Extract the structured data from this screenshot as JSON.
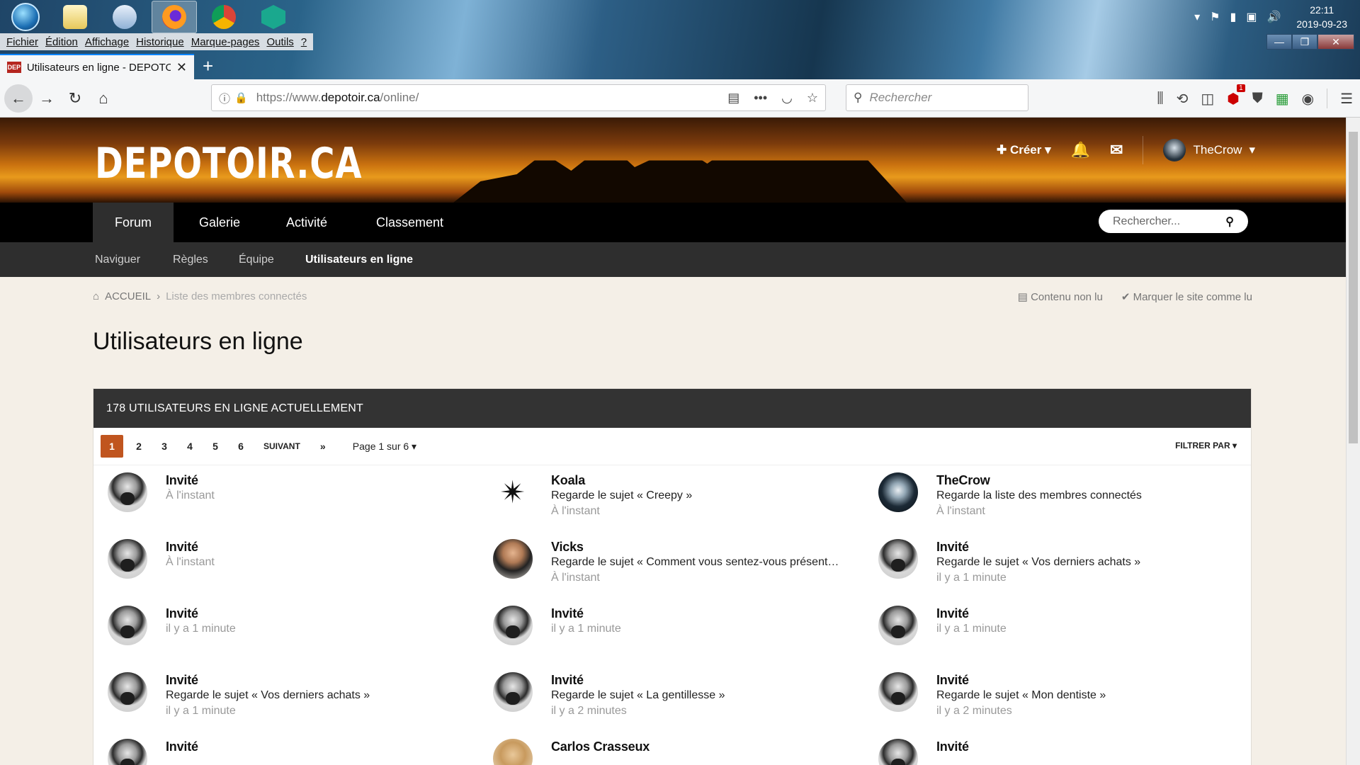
{
  "os": {
    "clock_time": "22:11",
    "clock_date": "2019-09-23"
  },
  "menu": [
    "Fichier",
    "Édition",
    "Affichage",
    "Historique",
    "Marque-pages",
    "Outils",
    "?"
  ],
  "tab": {
    "favicon": "DEP",
    "title": "Utilisateurs en ligne - DEPOTOIR.CA"
  },
  "url": {
    "prefix": "https://www.",
    "host": "depotoir.ca",
    "path": "/online/"
  },
  "browser_search_placeholder": "Rechercher",
  "ublock_count": "1",
  "site": {
    "logo": "DEPOTOIR.CA",
    "create_label": "Créer",
    "username": "TheCrow",
    "nav": [
      "Forum",
      "Galerie",
      "Activité",
      "Classement"
    ],
    "search_placeholder": "Rechercher...",
    "subnav": [
      "Naviguer",
      "Règles",
      "Équipe",
      "Utilisateurs en ligne"
    ],
    "breadcrumb_home": "ACCUEIL",
    "breadcrumb_current": "Liste des membres connectés",
    "unread_label": "Contenu non lu",
    "mark_read_label": "Marquer le site comme lu",
    "page_title": "Utilisateurs en ligne",
    "panel_title": "178 UTILISATEURS EN LIGNE ACTUELLEMENT",
    "pages": [
      "1",
      "2",
      "3",
      "4",
      "5",
      "6"
    ],
    "next_label": "SUIVANT",
    "last_label": "»",
    "page_select": "Page 1 sur 6",
    "filter_label": "FILTRER PAR"
  },
  "members": [
    {
      "name": "Invité",
      "activity": "",
      "time": "À l'instant",
      "avatar": "guest"
    },
    {
      "name": "Koala",
      "activity": "Regarde le sujet « Creepy »",
      "time": "À l'instant",
      "avatar": "koala"
    },
    {
      "name": "TheCrow",
      "activity": "Regarde la liste des membres connectés",
      "time": "À l'instant",
      "avatar": "crow"
    },
    {
      "name": "Invité",
      "activity": "",
      "time": "À l'instant",
      "avatar": "guest"
    },
    {
      "name": "Vicks",
      "activity": "Regarde le sujet « Comment vous sentez-vous présente…",
      "time": "À l'instant",
      "avatar": "vicks"
    },
    {
      "name": "Invité",
      "activity": "Regarde le sujet « Vos derniers achats »",
      "time": "il y a 1 minute",
      "avatar": "guest"
    },
    {
      "name": "Invité",
      "activity": "",
      "time": "il y a 1 minute",
      "avatar": "guest"
    },
    {
      "name": "Invité",
      "activity": "",
      "time": "il y a 1 minute",
      "avatar": "guest"
    },
    {
      "name": "Invité",
      "activity": "",
      "time": "il y a 1 minute",
      "avatar": "guest"
    },
    {
      "name": "Invité",
      "activity": "Regarde le sujet « Vos derniers achats »",
      "time": "il y a 1 minute",
      "avatar": "guest"
    },
    {
      "name": "Invité",
      "activity": "Regarde le sujet « La gentillesse »",
      "time": "il y a 2 minutes",
      "avatar": "guest"
    },
    {
      "name": "Invité",
      "activity": "Regarde le sujet « Mon dentiste »",
      "time": "il y a 2 minutes",
      "avatar": "guest"
    },
    {
      "name": "Invité",
      "activity": "",
      "time": "",
      "avatar": "guest"
    },
    {
      "name": "Carlos Crasseux",
      "activity": "",
      "time": "",
      "avatar": "carlos"
    },
    {
      "name": "Invité",
      "activity": "",
      "time": "",
      "avatar": "guest"
    }
  ]
}
